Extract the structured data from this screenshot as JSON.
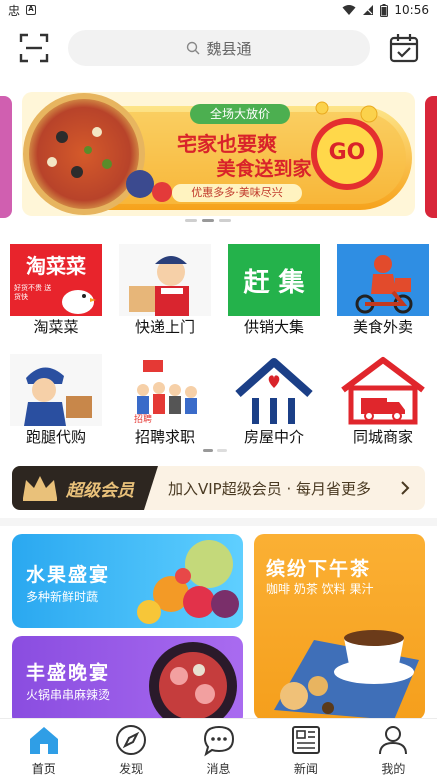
{
  "status_bar": {
    "time": "10:56",
    "icons": [
      "notification-icon",
      "app-icon"
    ]
  },
  "search": {
    "placeholder": "魏县通"
  },
  "banner": {
    "tag": "全场大放价",
    "headline": "宅家也要爽",
    "subheadline": "美食送到家",
    "go": "GO",
    "slogan": "优惠多多·美味尽兴"
  },
  "services": [
    {
      "label": "淘菜菜",
      "thumb_text": "淘菜菜",
      "thumb_sub": "好货不贵 送货快"
    },
    {
      "label": "快递上门"
    },
    {
      "label": "供销大集",
      "thumb_text": "赶 集"
    },
    {
      "label": "美食外卖"
    },
    {
      "label": "跑腿代购"
    },
    {
      "label": "招聘求职",
      "thumb_text": "招聘"
    },
    {
      "label": "房屋中介"
    },
    {
      "label": "同城商家"
    }
  ],
  "vip": {
    "title": "超级会员",
    "text": "加入VIP超级会员 · 每月省更多"
  },
  "cards": {
    "fruit": {
      "title": "水果盛宴",
      "sub": "多种新鲜时蔬"
    },
    "tea": {
      "title": "缤纷下午茶",
      "sub": "咖啡 奶茶 饮料 果汁"
    },
    "dinner": {
      "title": "丰盛晚宴",
      "sub": "火锅串串麻辣烫"
    }
  },
  "tabs": [
    {
      "label": "首页",
      "icon": "home-icon",
      "active": true
    },
    {
      "label": "发现",
      "icon": "compass-icon",
      "active": false
    },
    {
      "label": "消息",
      "icon": "message-icon",
      "active": false
    },
    {
      "label": "新闻",
      "icon": "news-icon",
      "active": false
    },
    {
      "label": "我的",
      "icon": "profile-icon",
      "active": false
    }
  ],
  "colors": {
    "accent": "#2f9ee6",
    "banner_orange": "#f6a21b",
    "vip_gold": "#e9c17a"
  }
}
